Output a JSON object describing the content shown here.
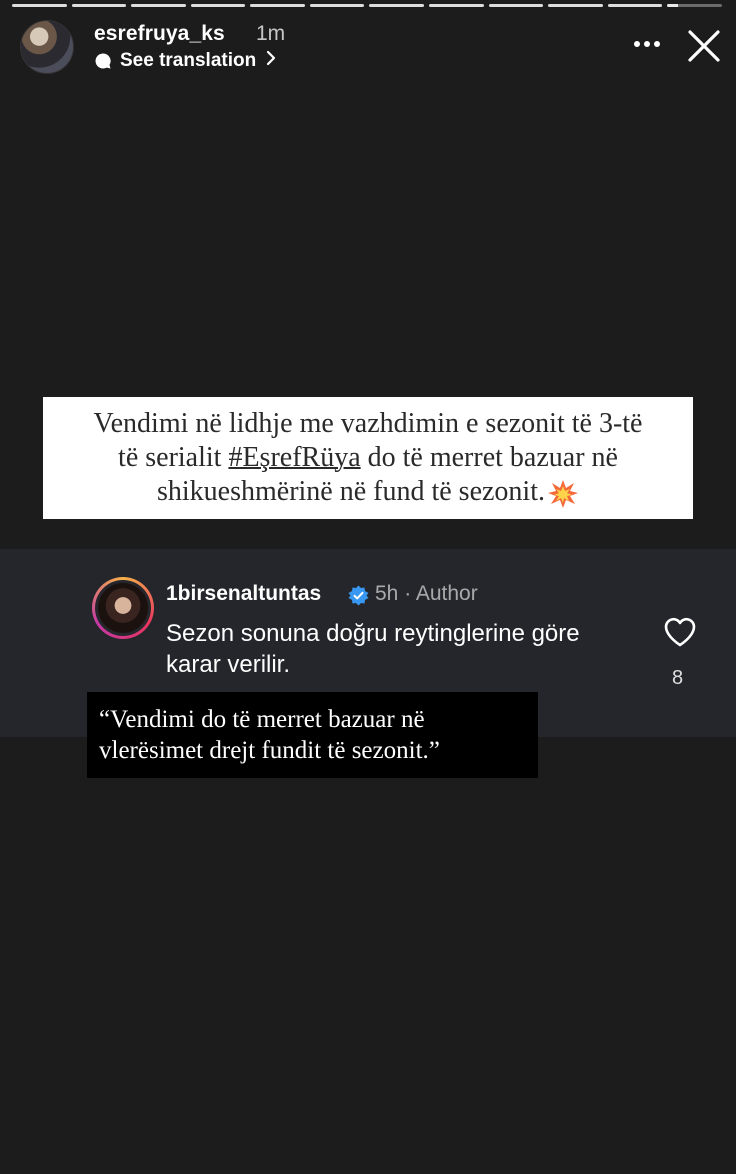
{
  "story": {
    "segments": 12,
    "current_segment": 12,
    "current_progress": 0.2
  },
  "header": {
    "username": "esrefruya_ks",
    "time": "1m",
    "translate_label": "See translation"
  },
  "icons": {
    "more": "more-horizontal-icon",
    "close": "close-icon",
    "translate": "chat-bubble-icon",
    "heart": "heart-outline-icon",
    "verified": "verified-badge-icon",
    "burst": "collision-emoji-icon"
  },
  "headline": {
    "line1": "Vendimi në lidhje me vazhdimin e sezonit të 3-të",
    "line2_prefix": "të serialit ",
    "hashtag": "#EşrefRüya",
    "line2_suffix": " do të merret bazuar në",
    "line3": "shikueshmërinë në fund të sezonit."
  },
  "comment": {
    "username": "1birsenaltuntas",
    "meta": "5h · Author",
    "text": "Sezon sonuna doğru reytinglerine göre karar verilir.",
    "likes": "8",
    "verified_color": "#3897f0"
  },
  "quote": {
    "line1": "“Vendimi do të merret bazuar në",
    "line2": "vlerësimet drejt fundit të sezonit.”"
  },
  "colors": {
    "background": "#1c1c1c",
    "comment_panel": "#25262b",
    "card": "#ffffff",
    "quote_bg": "#000000"
  }
}
